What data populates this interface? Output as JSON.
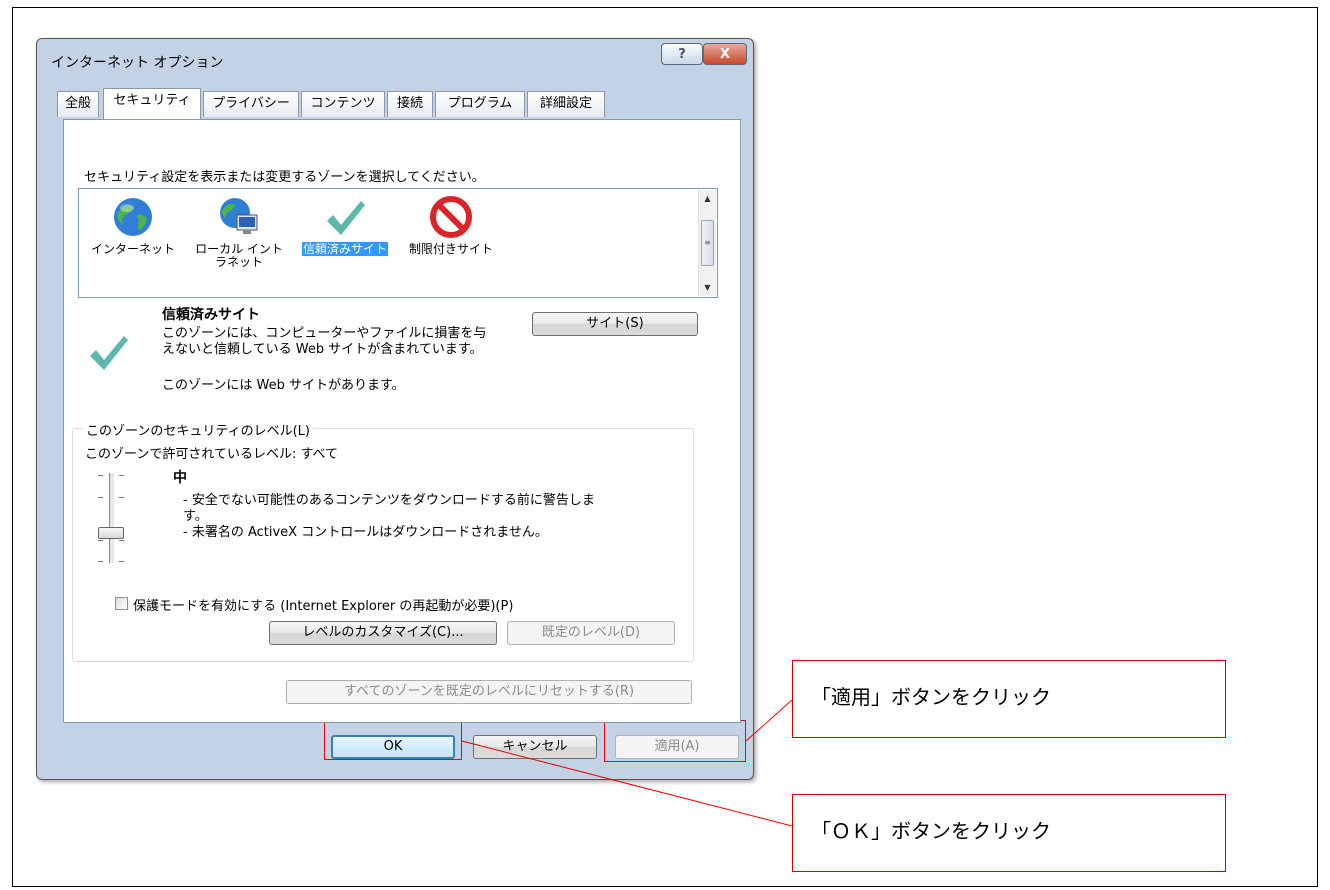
{
  "dialog": {
    "title": "インターネット オプション",
    "help_glyph": "?",
    "close_glyph": "X"
  },
  "tabs": [
    "全般",
    "セキュリティ",
    "プライバシー",
    "コンテンツ",
    "接続",
    "プログラム",
    "詳細設定"
  ],
  "active_tab": "セキュリティ",
  "security": {
    "instruction": "セキュリティ設定を表示または変更するゾーンを選択してください。",
    "zones": [
      {
        "label": "インターネット",
        "icon": "globe-icon"
      },
      {
        "label": "ローカル イントラネット",
        "label_line1": "ローカル イント",
        "label_line2": "ラネット",
        "icon": "local-intranet-icon"
      },
      {
        "label": "信頼済みサイト",
        "icon": "checkmark-icon",
        "selected": true
      },
      {
        "label": "制限付きサイト",
        "icon": "no-entry-icon"
      }
    ],
    "zone_title": "信頼済みサイト",
    "zone_desc_line1": "このゾーンには、コンピューターやファイルに損害を与",
    "zone_desc_line2": "えないと信頼している Web サイトが含まれています。",
    "zone_sites_note": "このゾーンには Web サイトがあります。",
    "sites_button": "サイト(S)",
    "level_group_title": "このゾーンのセキュリティのレベル(L)",
    "allowed_levels": "このゾーンで許可されているレベル: すべて",
    "level_name": "中",
    "level_desc_line1": "- 安全でない可能性のあるコンテンツをダウンロードする前に警告しま",
    "level_desc_line2": "す。",
    "level_desc_line3": "- 未署名の ActiveX コントロールはダウンロードされません。",
    "slider_level_step": 2,
    "slider_steps": 4,
    "protected_mode_label": "保護モードを有効にする (Internet Explorer の再起動が必要)(P)",
    "protected_mode_checked": false,
    "custom_level_button": "レベルのカスタマイズ(C)...",
    "default_level_button": "既定のレベル(D)",
    "reset_all_button": "すべてのゾーンを既定のレベルにリセットする(R)"
  },
  "footer": {
    "ok": "OK",
    "cancel": "キャンセル",
    "apply": "適用(A)"
  },
  "annotations": {
    "apply_callout": "「適用」ボタンをクリック",
    "ok_callout": "「ＯＫ」ボタンをクリック",
    "color": "#e00000"
  },
  "colors": {
    "selection": "#3399ff",
    "dialog_frame": "#c3d3e5",
    "default_button_border": "#3c7fb1"
  }
}
